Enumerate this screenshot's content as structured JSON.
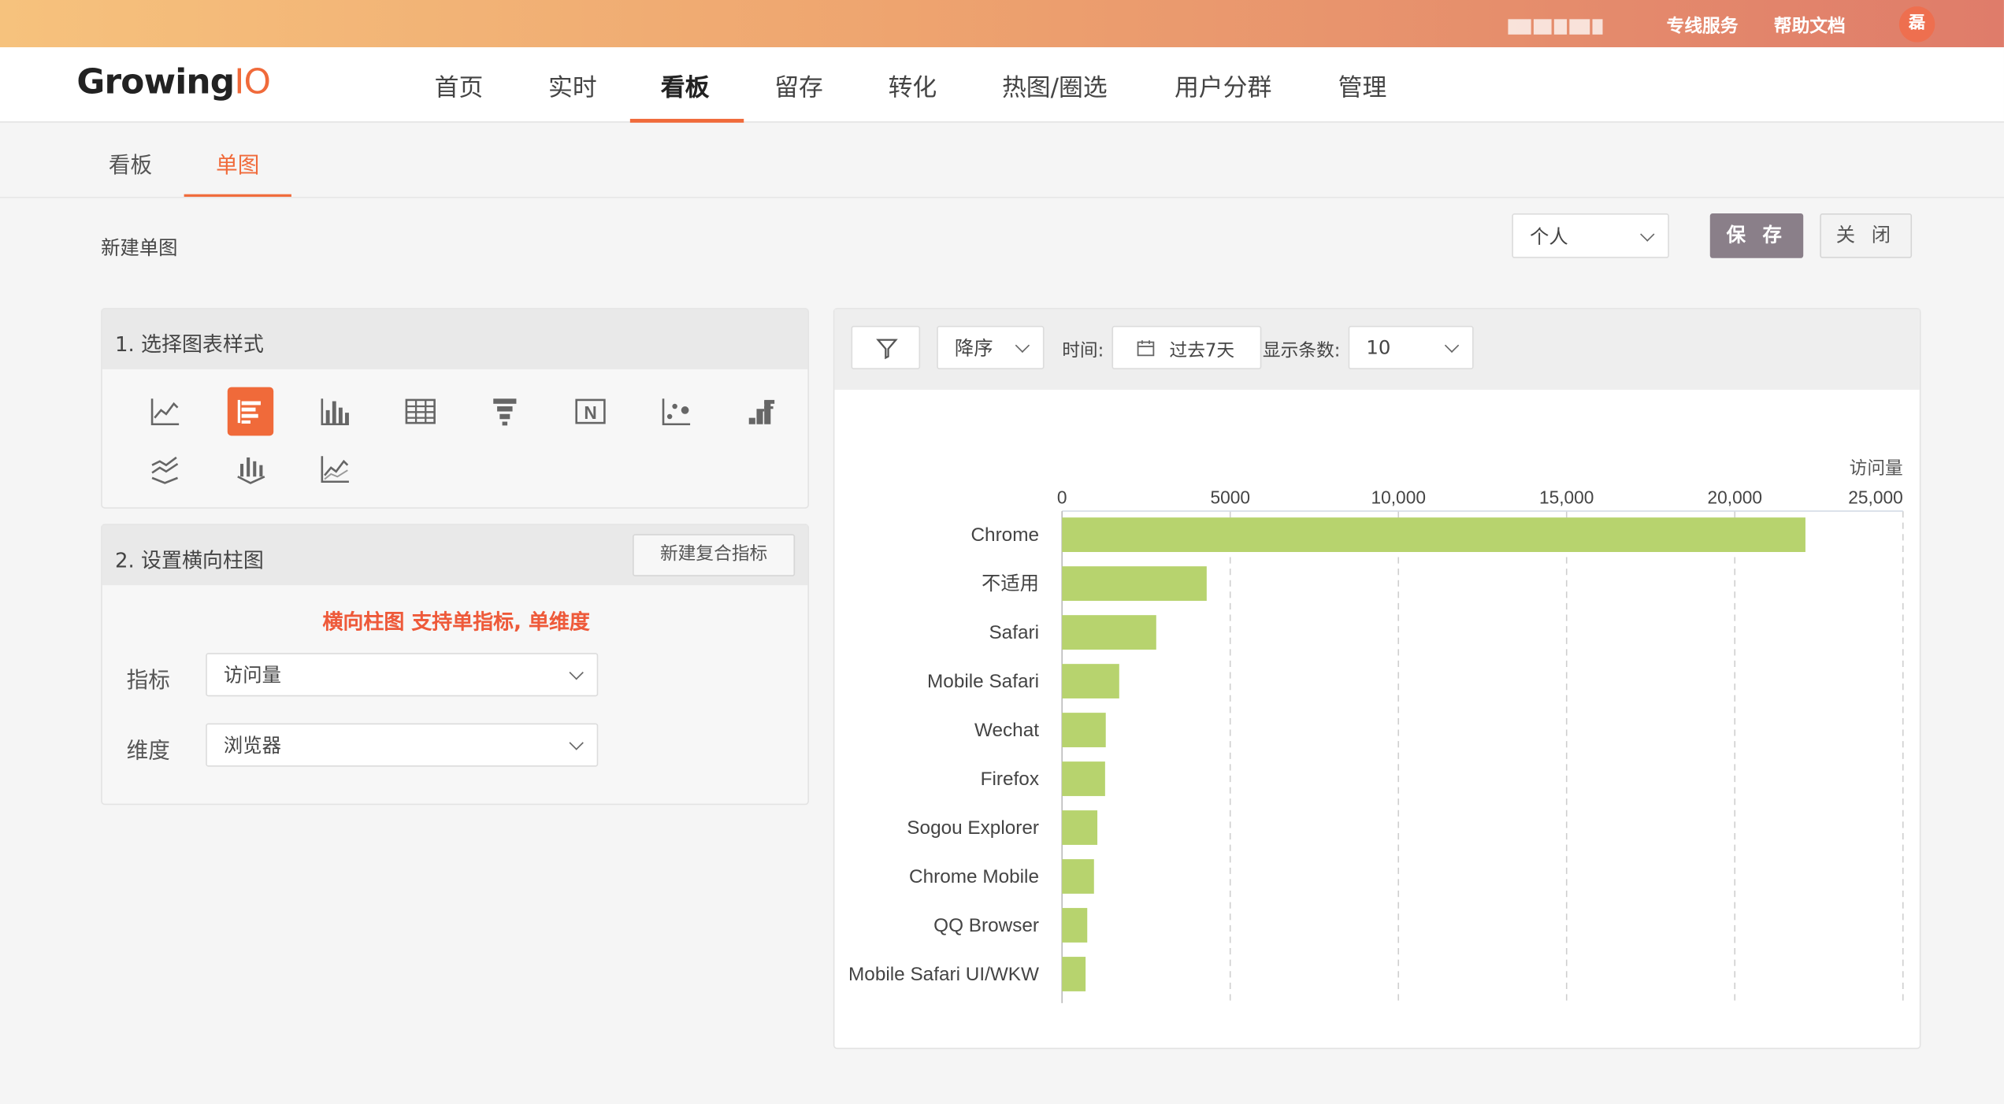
{
  "topbar": {
    "links": [
      "专线服务",
      "帮助文档"
    ],
    "avatar_text": "磊"
  },
  "brand": {
    "name_a": "Growing",
    "name_b": "IO"
  },
  "nav": {
    "items": [
      "首页",
      "实时",
      "看板",
      "留存",
      "转化",
      "热图/圈选",
      "用户分群",
      "管理"
    ],
    "active": "看板"
  },
  "subnav": {
    "tabs": [
      "看板",
      "单图"
    ],
    "active": "单图"
  },
  "page": {
    "title": "新建单图",
    "scope_select": "个人",
    "save_label": "保 存",
    "close_label": "关 闭"
  },
  "panel1": {
    "title": "1. 选择图表样式",
    "icons": [
      "line-chart-icon",
      "horizontal-bar-chart-icon",
      "vertical-bar-chart-icon",
      "table-icon",
      "funnel-icon",
      "number-card-icon",
      "scatter-icon",
      "stacked-bar-icon",
      "stacked-area-icon",
      "stacked-column-icon",
      "area-line-icon"
    ],
    "selected_icon": "horizontal-bar-chart-icon"
  },
  "panel2": {
    "title": "2. 设置横向柱图",
    "new_metric_button": "新建复合指标",
    "hint": "横向柱图 支持单指标, 单维度",
    "metric_label": "指标",
    "metric_value": "访问量",
    "dimension_label": "维度",
    "dimension_value": "浏览器"
  },
  "toolbar": {
    "sort_value": "降序",
    "time_label": "时间:",
    "time_value": "过去7天",
    "count_label": "显示条数:",
    "count_value": "10"
  },
  "chart_data": {
    "type": "bar",
    "orientation": "horizontal",
    "unit_label": "访问量",
    "categories": [
      "Chrome",
      "不适用",
      "Safari",
      "Mobile Safari",
      "Wechat",
      "Firefox",
      "Sogou Explorer",
      "Chrome Mobile",
      "QQ Browser",
      "Mobile Safari UI/WKW"
    ],
    "values": [
      22100,
      4300,
      2800,
      1700,
      1300,
      1280,
      1050,
      950,
      750,
      700
    ],
    "xlim": [
      0,
      25000
    ],
    "ticks": [
      "0",
      "5000",
      "10,000",
      "15,000",
      "20,000",
      "25,000"
    ],
    "bar_color": "#b7d36e",
    "grid": true
  }
}
